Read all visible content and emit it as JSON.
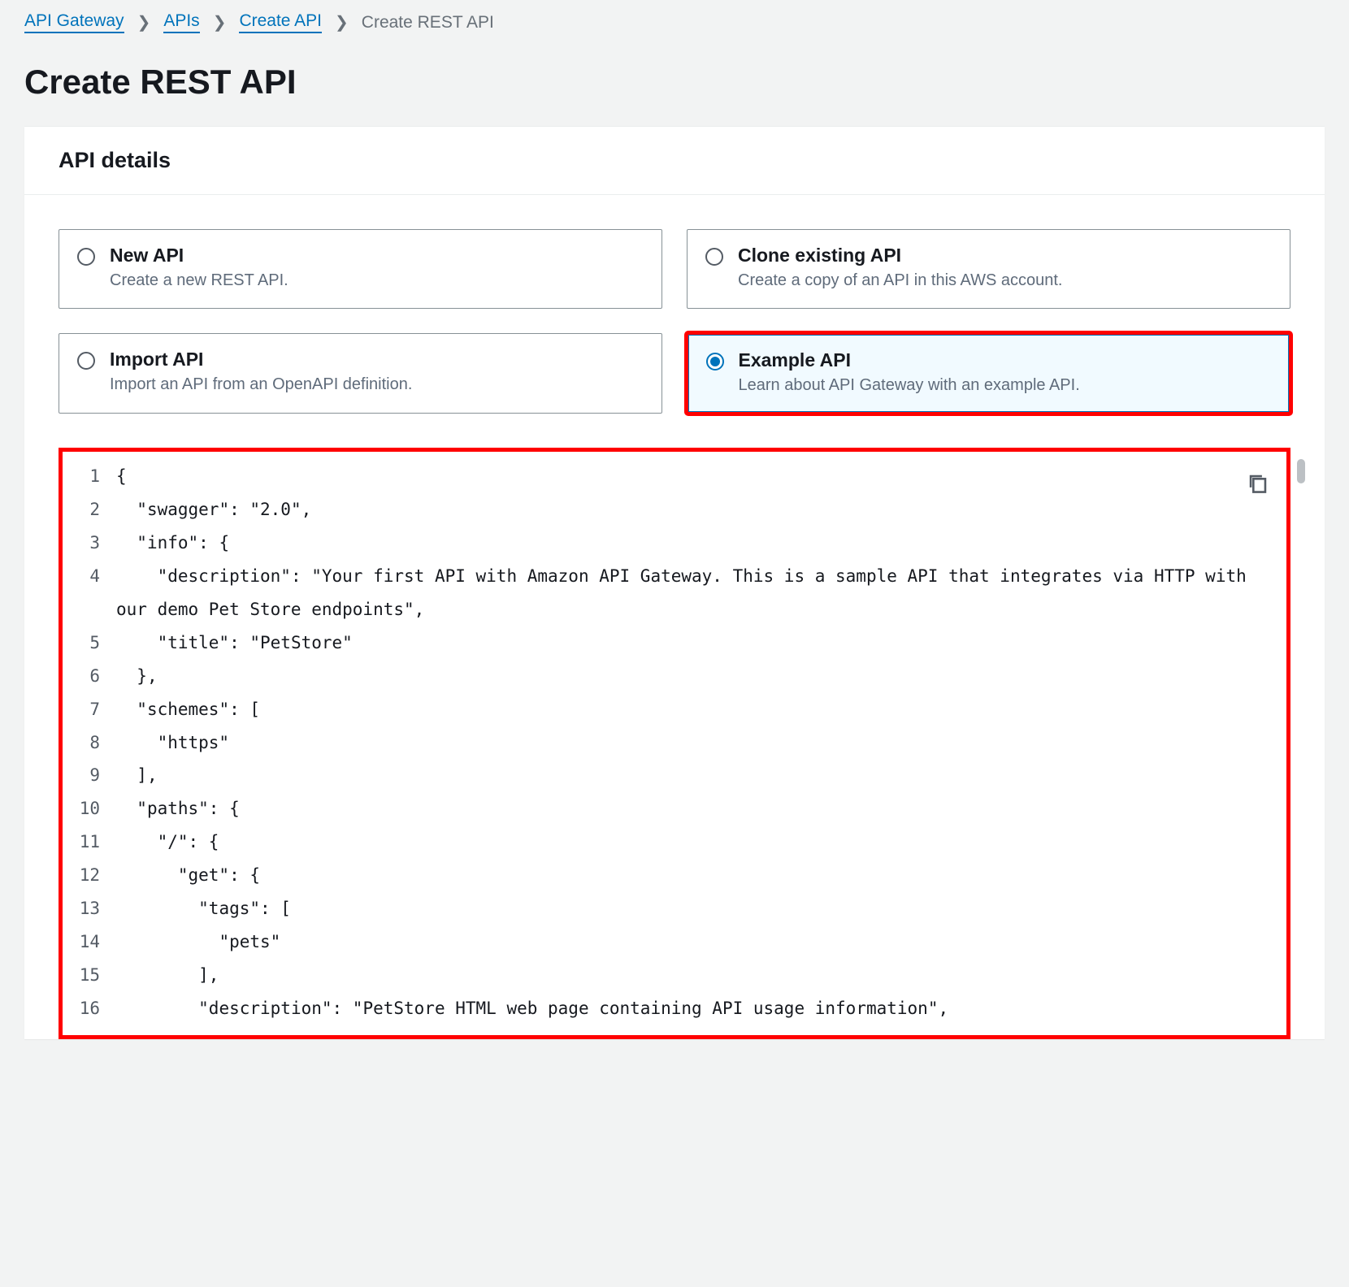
{
  "breadcrumb": {
    "items": [
      {
        "label": "API Gateway",
        "link": true
      },
      {
        "label": "APIs",
        "link": true
      },
      {
        "label": "Create API",
        "link": true
      },
      {
        "label": "Create REST API",
        "link": false
      }
    ]
  },
  "page_title": "Create REST API",
  "panel": {
    "title": "API details"
  },
  "options": {
    "new_api": {
      "title": "New API",
      "desc": "Create a new REST API.",
      "selected": false
    },
    "clone_api": {
      "title": "Clone existing API",
      "desc": "Create a copy of an API in this AWS account.",
      "selected": false
    },
    "import_api": {
      "title": "Import API",
      "desc": "Import an API from an OpenAPI definition.",
      "selected": false
    },
    "example_api": {
      "title": "Example API",
      "desc": "Learn about API Gateway with an example API.",
      "selected": true
    }
  },
  "code": {
    "lines": [
      "{",
      "  \"swagger\": \"2.0\",",
      "  \"info\": {",
      "    \"description\": \"Your first API with Amazon API Gateway. This is a sample API that integrates via HTTP with our demo Pet Store endpoints\",",
      "    \"title\": \"PetStore\"",
      "  },",
      "  \"schemes\": [",
      "    \"https\"",
      "  ],",
      "  \"paths\": {",
      "    \"/\": {",
      "      \"get\": {",
      "        \"tags\": [",
      "          \"pets\"",
      "        ],",
      "        \"description\": \"PetStore HTML web page containing API usage information\","
    ]
  }
}
